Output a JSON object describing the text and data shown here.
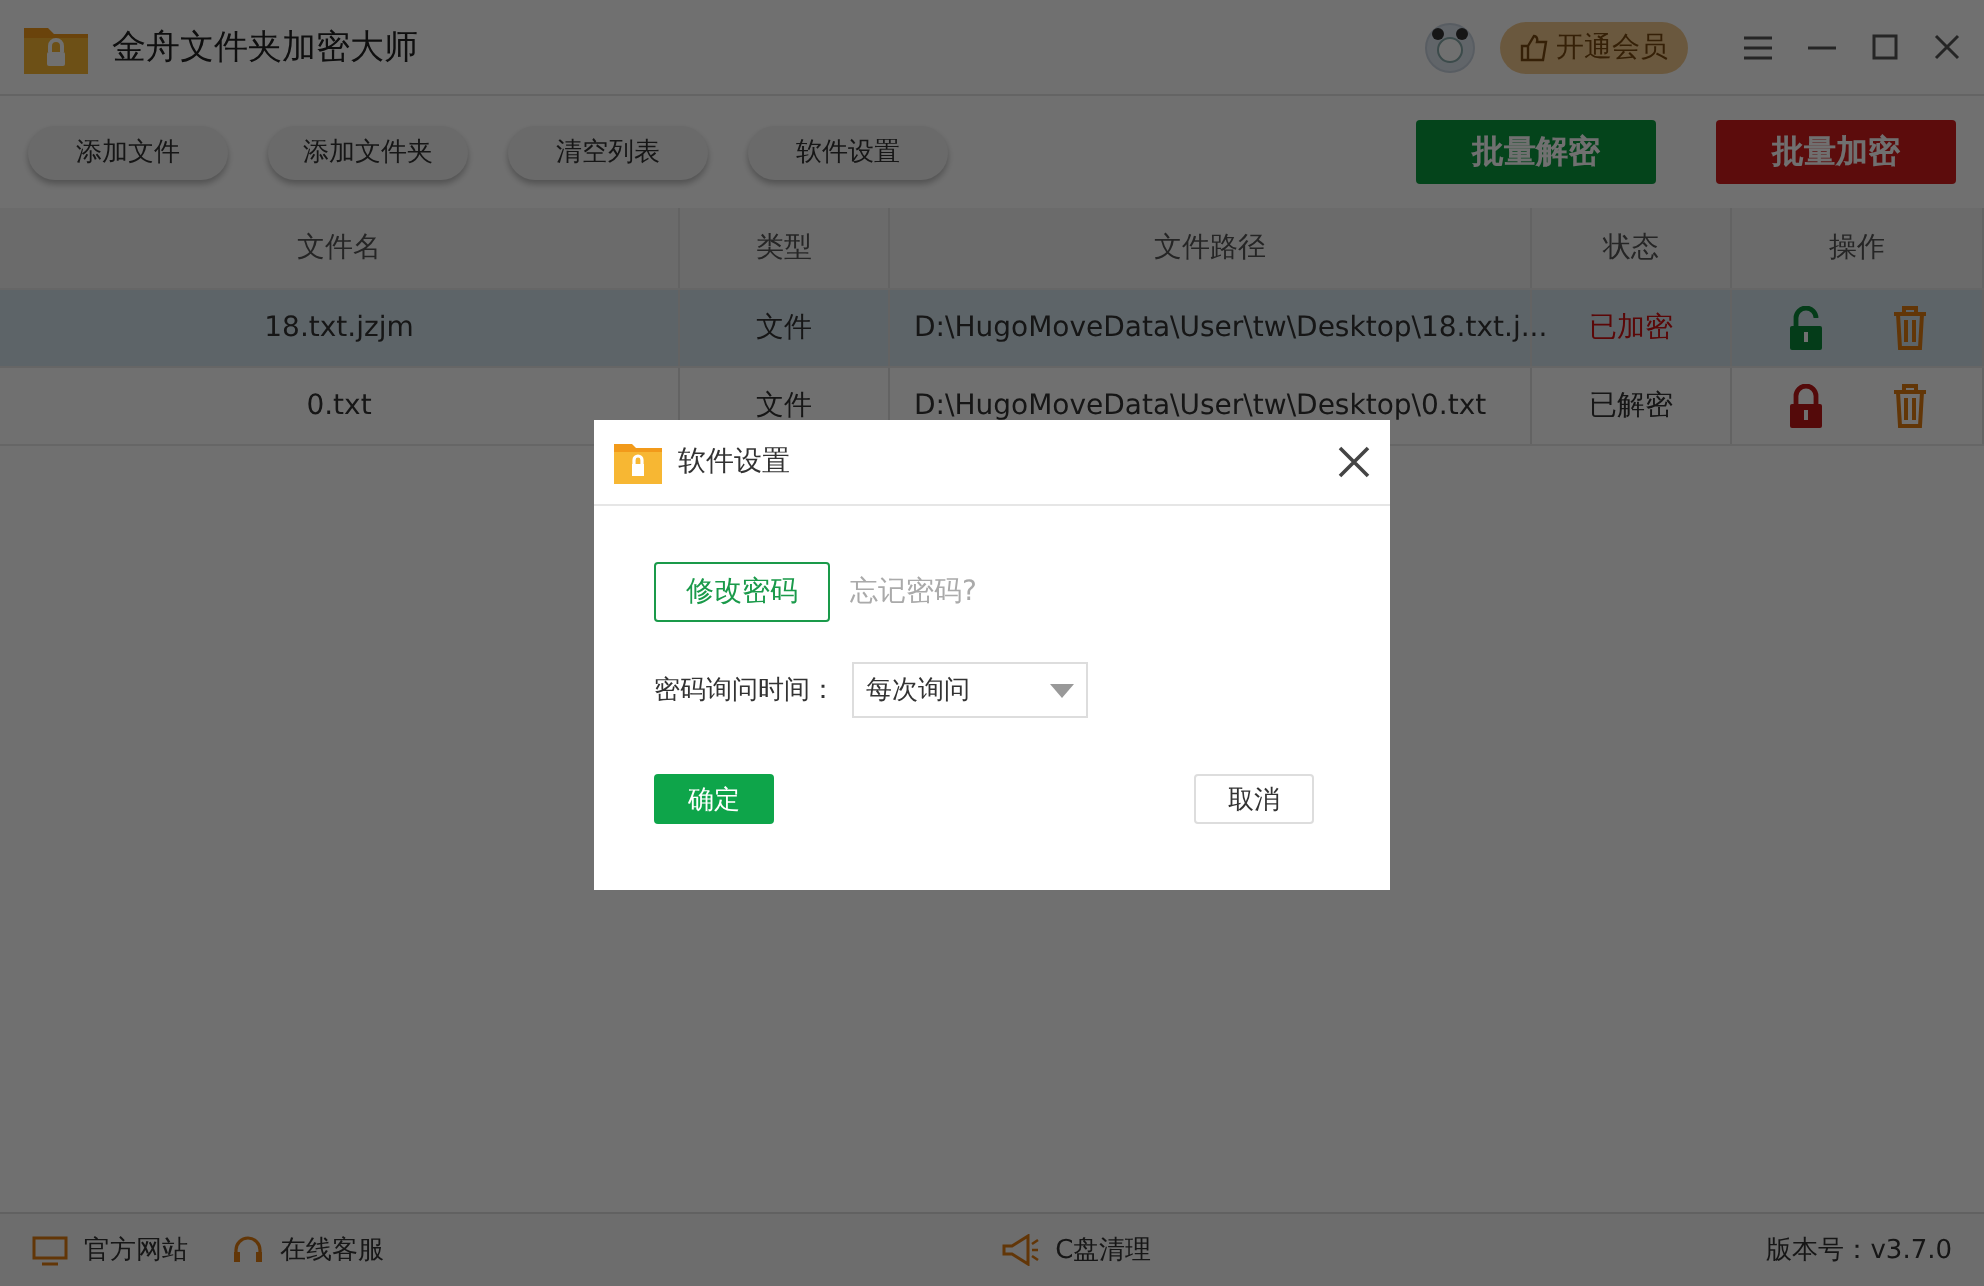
{
  "window": {
    "title": "金舟文件夹加密大师",
    "vip_button": "开通会员"
  },
  "toolbar": {
    "buttons": [
      "添加文件",
      "添加文件夹",
      "清空列表",
      "软件设置"
    ],
    "decrypt_all": "批量解密",
    "encrypt_all": "批量加密"
  },
  "table": {
    "columns": [
      "文件名",
      "类型",
      "文件路径",
      "状态",
      "操作"
    ],
    "rows": [
      {
        "name": "18.txt.jzjm",
        "type": "文件",
        "path": "D:\\HugoMoveData\\User\\tw\\Desktop\\18.txt.j...",
        "status": "已加密",
        "encrypted": true,
        "selected": true
      },
      {
        "name": "0.txt",
        "type": "文件",
        "path": "D:\\HugoMoveData\\User\\tw\\Desktop\\0.txt",
        "status": "已解密",
        "encrypted": false,
        "selected": false
      }
    ]
  },
  "status_bar": {
    "website": "官方网站",
    "support": "在线客服",
    "cleanup": "C盘清理",
    "version": "版本号：v3.7.0"
  },
  "dialog": {
    "title": "软件设置",
    "change_password": "修改密码",
    "forgot_password": "忘记密码?",
    "ask_label": "密码询问时间：",
    "ask_value": "每次询问",
    "ok": "确定",
    "cancel": "取消"
  }
}
